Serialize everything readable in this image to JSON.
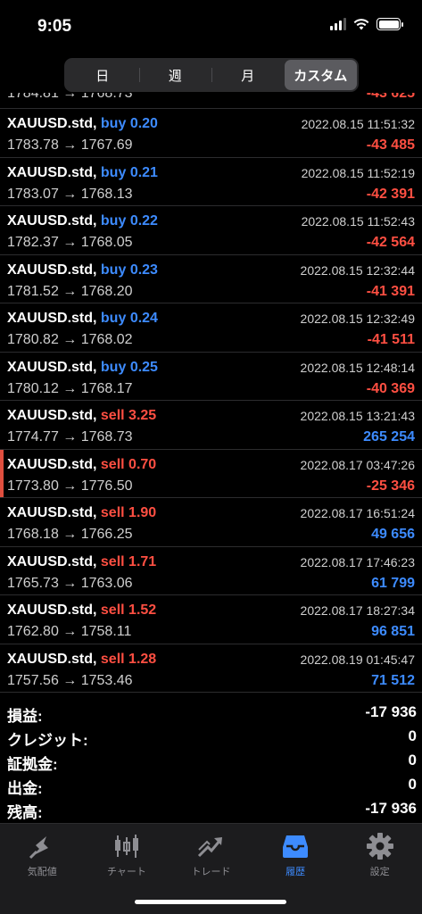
{
  "status": {
    "time": "9:05"
  },
  "segments": [
    {
      "label": "日",
      "active": false
    },
    {
      "label": "週",
      "active": false
    },
    {
      "label": "月",
      "active": false
    },
    {
      "label": "カスタム",
      "active": true
    }
  ],
  "partial_row": {
    "prices": "1784.81 → 1768.73",
    "profit": "-43 625"
  },
  "trades": [
    {
      "symbol": "XAUUSD.std,",
      "side": "buy",
      "volume": "0.20",
      "date": "2022.08.15 11:51:32",
      "prices": "1783.78 → 1767.69",
      "profit": "-43 485",
      "profit_sign": "neg"
    },
    {
      "symbol": "XAUUSD.std,",
      "side": "buy",
      "volume": "0.21",
      "date": "2022.08.15 11:52:19",
      "prices": "1783.07 → 1768.13",
      "profit": "-42 391",
      "profit_sign": "neg"
    },
    {
      "symbol": "XAUUSD.std,",
      "side": "buy",
      "volume": "0.22",
      "date": "2022.08.15 11:52:43",
      "prices": "1782.37 → 1768.05",
      "profit": "-42 564",
      "profit_sign": "neg"
    },
    {
      "symbol": "XAUUSD.std,",
      "side": "buy",
      "volume": "0.23",
      "date": "2022.08.15 12:32:44",
      "prices": "1781.52 → 1768.20",
      "profit": "-41 391",
      "profit_sign": "neg"
    },
    {
      "symbol": "XAUUSD.std,",
      "side": "buy",
      "volume": "0.24",
      "date": "2022.08.15 12:32:49",
      "prices": "1780.82 → 1768.02",
      "profit": "-41 511",
      "profit_sign": "neg"
    },
    {
      "symbol": "XAUUSD.std,",
      "side": "buy",
      "volume": "0.25",
      "date": "2022.08.15 12:48:14",
      "prices": "1780.12 → 1768.17",
      "profit": "-40 369",
      "profit_sign": "neg"
    },
    {
      "symbol": "XAUUSD.std,",
      "side": "sell",
      "volume": "3.25",
      "date": "2022.08.15 13:21:43",
      "prices": "1774.77 → 1768.73",
      "profit": "265 254",
      "profit_sign": "pos"
    },
    {
      "symbol": "XAUUSD.std,",
      "side": "sell",
      "volume": "0.70",
      "date": "2022.08.17 03:47:26",
      "prices": "1773.80 → 1776.50",
      "profit": "-25 346",
      "profit_sign": "neg",
      "selected": true
    },
    {
      "symbol": "XAUUSD.std,",
      "side": "sell",
      "volume": "1.90",
      "date": "2022.08.17 16:51:24",
      "prices": "1768.18 → 1766.25",
      "profit": "49 656",
      "profit_sign": "pos"
    },
    {
      "symbol": "XAUUSD.std,",
      "side": "sell",
      "volume": "1.71",
      "date": "2022.08.17 17:46:23",
      "prices": "1765.73 → 1763.06",
      "profit": "61 799",
      "profit_sign": "pos"
    },
    {
      "symbol": "XAUUSD.std,",
      "side": "sell",
      "volume": "1.52",
      "date": "2022.08.17 18:27:34",
      "prices": "1762.80 → 1758.11",
      "profit": "96 851",
      "profit_sign": "pos"
    },
    {
      "symbol": "XAUUSD.std,",
      "side": "sell",
      "volume": "1.28",
      "date": "2022.08.19 01:45:47",
      "prices": "1757.56 → 1753.46",
      "profit": "71 512",
      "profit_sign": "pos"
    }
  ],
  "summary": {
    "profit_label": "損益:",
    "profit_value": "-17 936",
    "credit_label": "クレジット:",
    "credit_value": "0",
    "margin_label": "証拠金:",
    "margin_value": "0",
    "withdraw_label": "出金:",
    "withdraw_value": "0",
    "balance_label": "残高:",
    "balance_value": "-17 936"
  },
  "tabs": [
    {
      "label": "気配値",
      "icon": "quotes-icon",
      "active": false
    },
    {
      "label": "チャート",
      "icon": "chart-candles-icon",
      "active": false
    },
    {
      "label": "トレード",
      "icon": "trade-icon",
      "active": false
    },
    {
      "label": "履歴",
      "icon": "history-inbox-icon",
      "active": true
    },
    {
      "label": "設定",
      "icon": "gear-icon",
      "active": false
    }
  ],
  "colors": {
    "buy": "#3d8bff",
    "sell": "#ff4f42",
    "accent": "#3d8bff"
  }
}
